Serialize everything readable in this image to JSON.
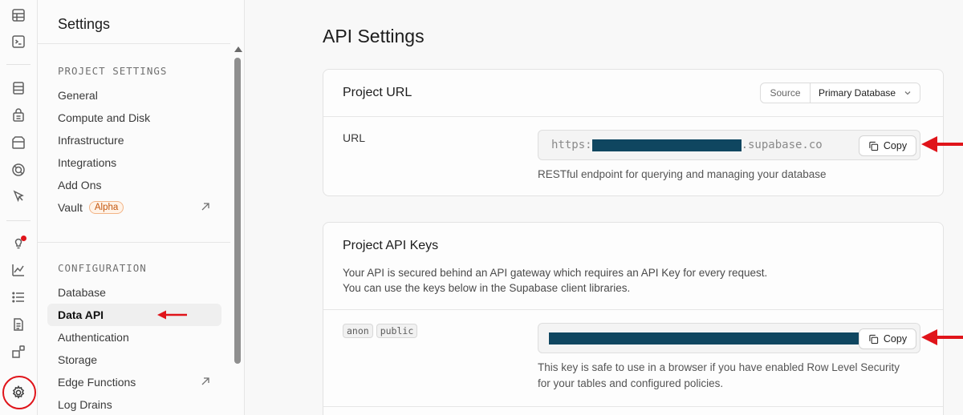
{
  "sidebar": {
    "title": "Settings",
    "project_settings_label": "PROJECT SETTINGS",
    "project_items": [
      {
        "label": "General"
      },
      {
        "label": "Compute and Disk"
      },
      {
        "label": "Infrastructure"
      },
      {
        "label": "Integrations"
      },
      {
        "label": "Add Ons"
      },
      {
        "label": "Vault",
        "badge": "Alpha",
        "external": true
      }
    ],
    "configuration_label": "CONFIGURATION",
    "config_items": [
      {
        "label": "Database"
      },
      {
        "label": "Data API",
        "active": true
      },
      {
        "label": "Authentication"
      },
      {
        "label": "Storage"
      },
      {
        "label": "Edge Functions",
        "external": true
      },
      {
        "label": "Log Drains"
      }
    ]
  },
  "main": {
    "title": "API Settings",
    "project_url": {
      "title": "Project URL",
      "source_label": "Source",
      "source_value": "Primary Database",
      "url_label": "URL",
      "url_prefix": "https:",
      "url_suffix": ".supabase.co",
      "copy_label": "Copy",
      "help": "RESTful endpoint for querying and managing your database"
    },
    "api_keys": {
      "title": "Project API Keys",
      "desc_line1": "Your API is secured behind an API gateway which requires an API Key for every request.",
      "desc_line2": "You can use the keys below in the Supabase client libraries.",
      "tags": [
        "anon",
        "public"
      ],
      "copy_label": "Copy",
      "help_line1": "This key is safe to use in a browser if you have enabled Row Level Security",
      "help_line2": "for your tables and configured policies."
    }
  },
  "colors": {
    "annotation_red": "#e0141a",
    "redaction": "#0f4660",
    "badge_orange": "#c4570f"
  }
}
